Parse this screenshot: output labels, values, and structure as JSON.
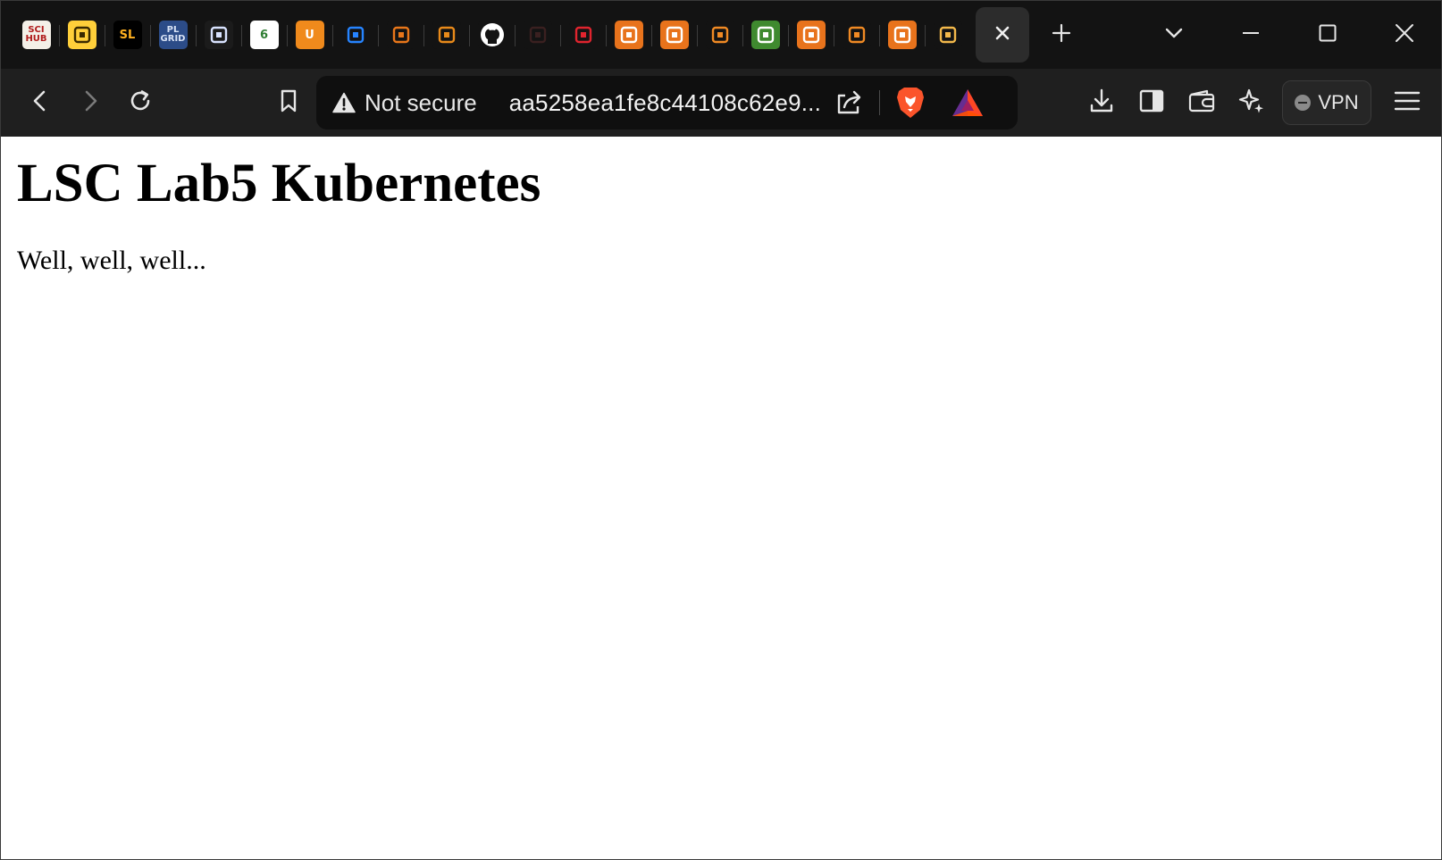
{
  "browser": {
    "pinned_tabs": [
      {
        "icon": "sci-hub-icon",
        "text": "SCI HUB",
        "bg": "#f4f0e8",
        "fg": "#b01c1c"
      },
      {
        "icon": "hugging-face-icon",
        "text": "",
        "bg": "#ffcf3a",
        "fg": "#3a2a00"
      },
      {
        "icon": "sl-logo-icon",
        "text": "SL",
        "bg": "#000000",
        "fg": "#ffb020"
      },
      {
        "icon": "plgrid-icon",
        "text": "PL GRID",
        "bg": "#2c4c88",
        "fg": "#d8e2f5"
      },
      {
        "icon": "lightbulb-search-icon",
        "text": "",
        "bg": "#1b1b1b",
        "fg": "#d9e3ff"
      },
      {
        "icon": "six-logo-icon",
        "text": "6",
        "bg": "#ffffff",
        "fg": "#2e7d32"
      },
      {
        "icon": "u-logo-icon",
        "text": "U",
        "bg": "#f08a1c",
        "fg": "#ffffff"
      },
      {
        "icon": "confluence-icon",
        "text": "",
        "bg": "#131313",
        "fg": "#2684ff"
      },
      {
        "icon": "orbit-arc-icon",
        "text": "",
        "bg": "#131313",
        "fg": "#e8761a"
      },
      {
        "icon": "orange-books-icon",
        "text": "",
        "bg": "#131313",
        "fg": "#e88a1a"
      },
      {
        "icon": "github-icon",
        "text": "",
        "bg": "#131313",
        "fg": "#ffffff"
      },
      {
        "icon": "dark-page-icon",
        "text": "",
        "bg": "#131313",
        "fg": "#3a2020"
      },
      {
        "icon": "red-wheel-icon",
        "text": "",
        "bg": "#131313",
        "fg": "#e0242e"
      },
      {
        "icon": "aws-service-icon",
        "text": "",
        "bg": "#e8731c",
        "fg": "#ffffff"
      },
      {
        "icon": "aws-service-icon",
        "text": "",
        "bg": "#e8731c",
        "fg": "#ffffff"
      },
      {
        "icon": "orange-cube-icon",
        "text": "",
        "bg": "#131313",
        "fg": "#f08a24"
      },
      {
        "icon": "green-service-icon",
        "text": "",
        "bg": "#3f8a2f",
        "fg": "#ffffff"
      },
      {
        "icon": "aws-copy-icon",
        "text": "",
        "bg": "#e8731c",
        "fg": "#ffffff"
      },
      {
        "icon": "orange-cube-icon",
        "text": "",
        "bg": "#131313",
        "fg": "#f08a24"
      },
      {
        "icon": "aws-copy-icon",
        "text": "",
        "bg": "#e8731c",
        "fg": "#ffffff"
      },
      {
        "icon": "package-box-icon",
        "text": "",
        "bg": "#131313",
        "fg": "#f2b84b"
      }
    ],
    "colors": {
      "tabstrip_bg": "#131313",
      "toolbar_bg": "#1f1f1f",
      "urlbar_bg": "#0f0f0f",
      "icon_fg": "#e6e6e6",
      "brave_orange": "#fb542b"
    },
    "address_bar": {
      "security_label": "Not secure",
      "url": "aa5258ea1fe8c44108c62e9..."
    },
    "vpn_label": "VPN"
  },
  "page": {
    "heading": "LSC Lab5 Kubernetes",
    "paragraph": "Well, well, well..."
  }
}
